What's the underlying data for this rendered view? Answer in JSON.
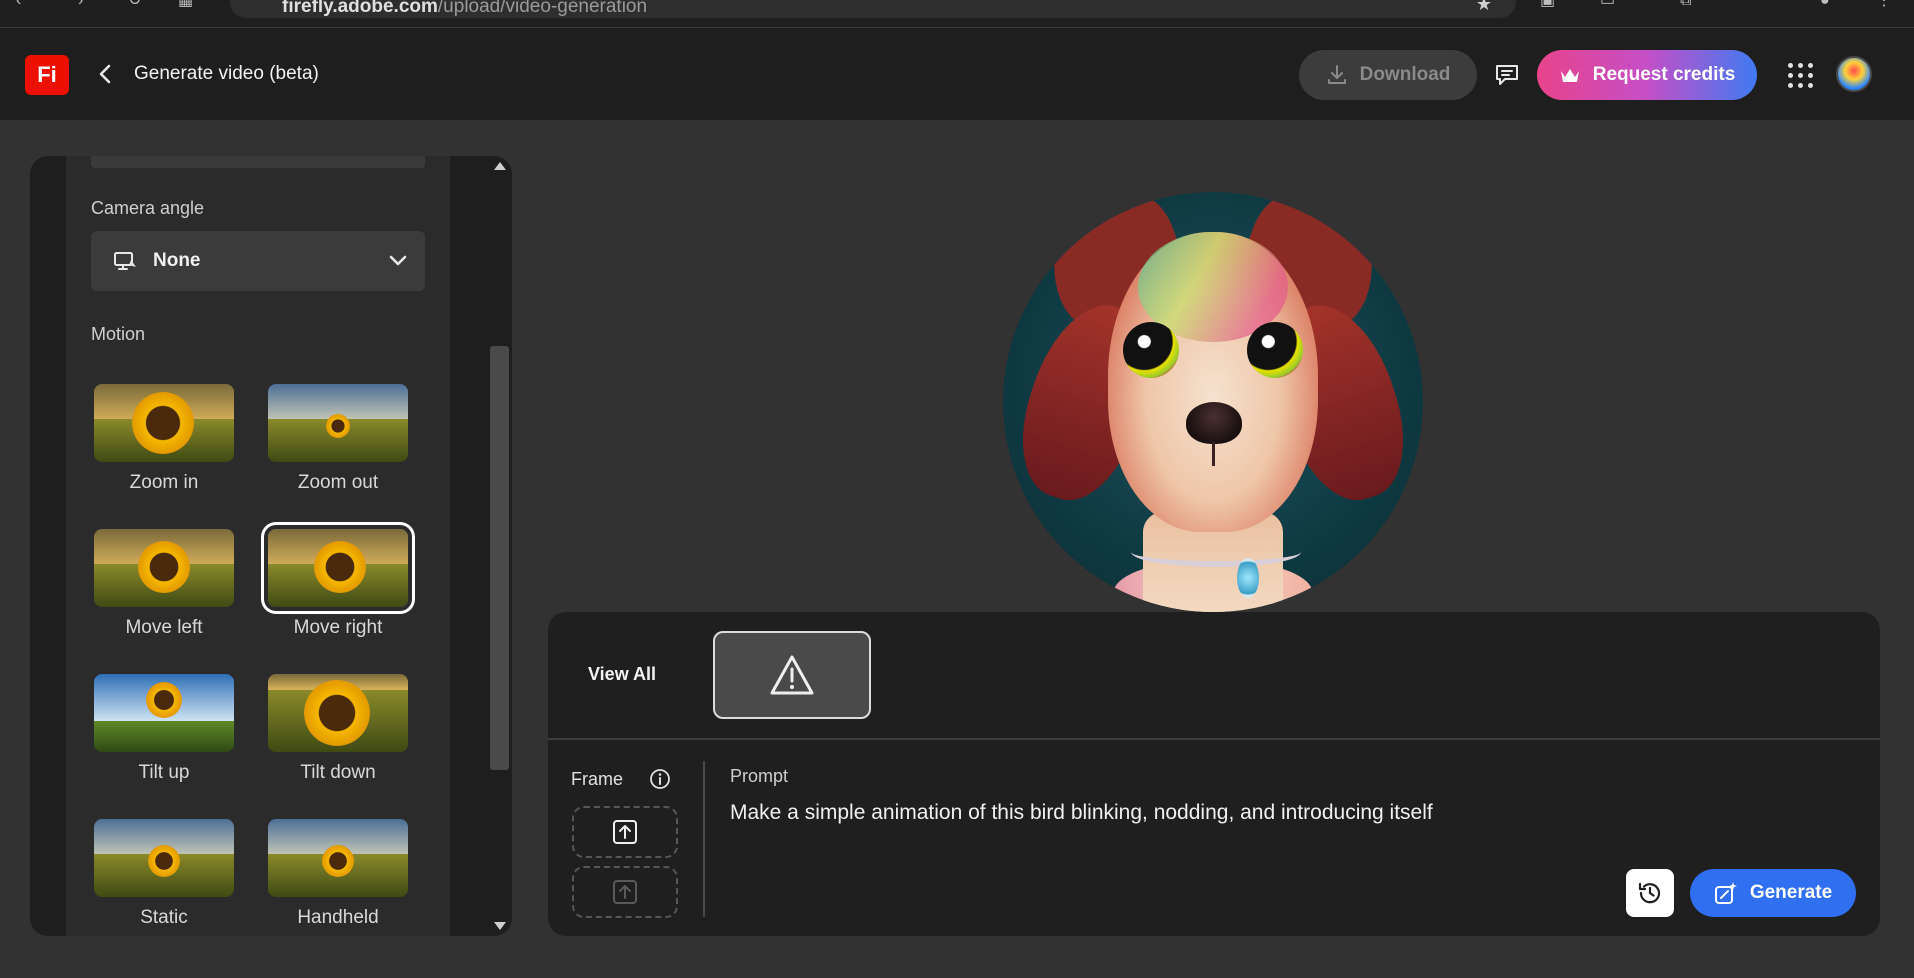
{
  "browser": {
    "url_host": "firefly.adobe.com",
    "url_path": "/upload/video-generation"
  },
  "header": {
    "logo_text": "Fi",
    "title": "Generate video (beta)",
    "download_label": "Download",
    "credits_label": "Request credits"
  },
  "left_panel": {
    "camera_angle_label": "Camera angle",
    "camera_angle_value": "None",
    "motion_label": "Motion",
    "motion_items": [
      {
        "label": "Zoom in"
      },
      {
        "label": "Zoom out"
      },
      {
        "label": "Move left"
      },
      {
        "label": "Move right",
        "selected": true
      },
      {
        "label": "Tilt up"
      },
      {
        "label": "Tilt down"
      },
      {
        "label": "Static"
      },
      {
        "label": "Handheld"
      }
    ]
  },
  "prompt_panel": {
    "view_all_label": "View All",
    "frame_label": "Frame",
    "prompt_label": "Prompt",
    "prompt_text": "Make a simple animation of this bird blinking, nodding, and introducing itself",
    "generate_label": "Generate"
  },
  "colors": {
    "accent": "#2f6ff0",
    "logo_red": "#eb1000",
    "credits_gradient_start": "#e8438a",
    "credits_gradient_end": "#3f7af2"
  }
}
